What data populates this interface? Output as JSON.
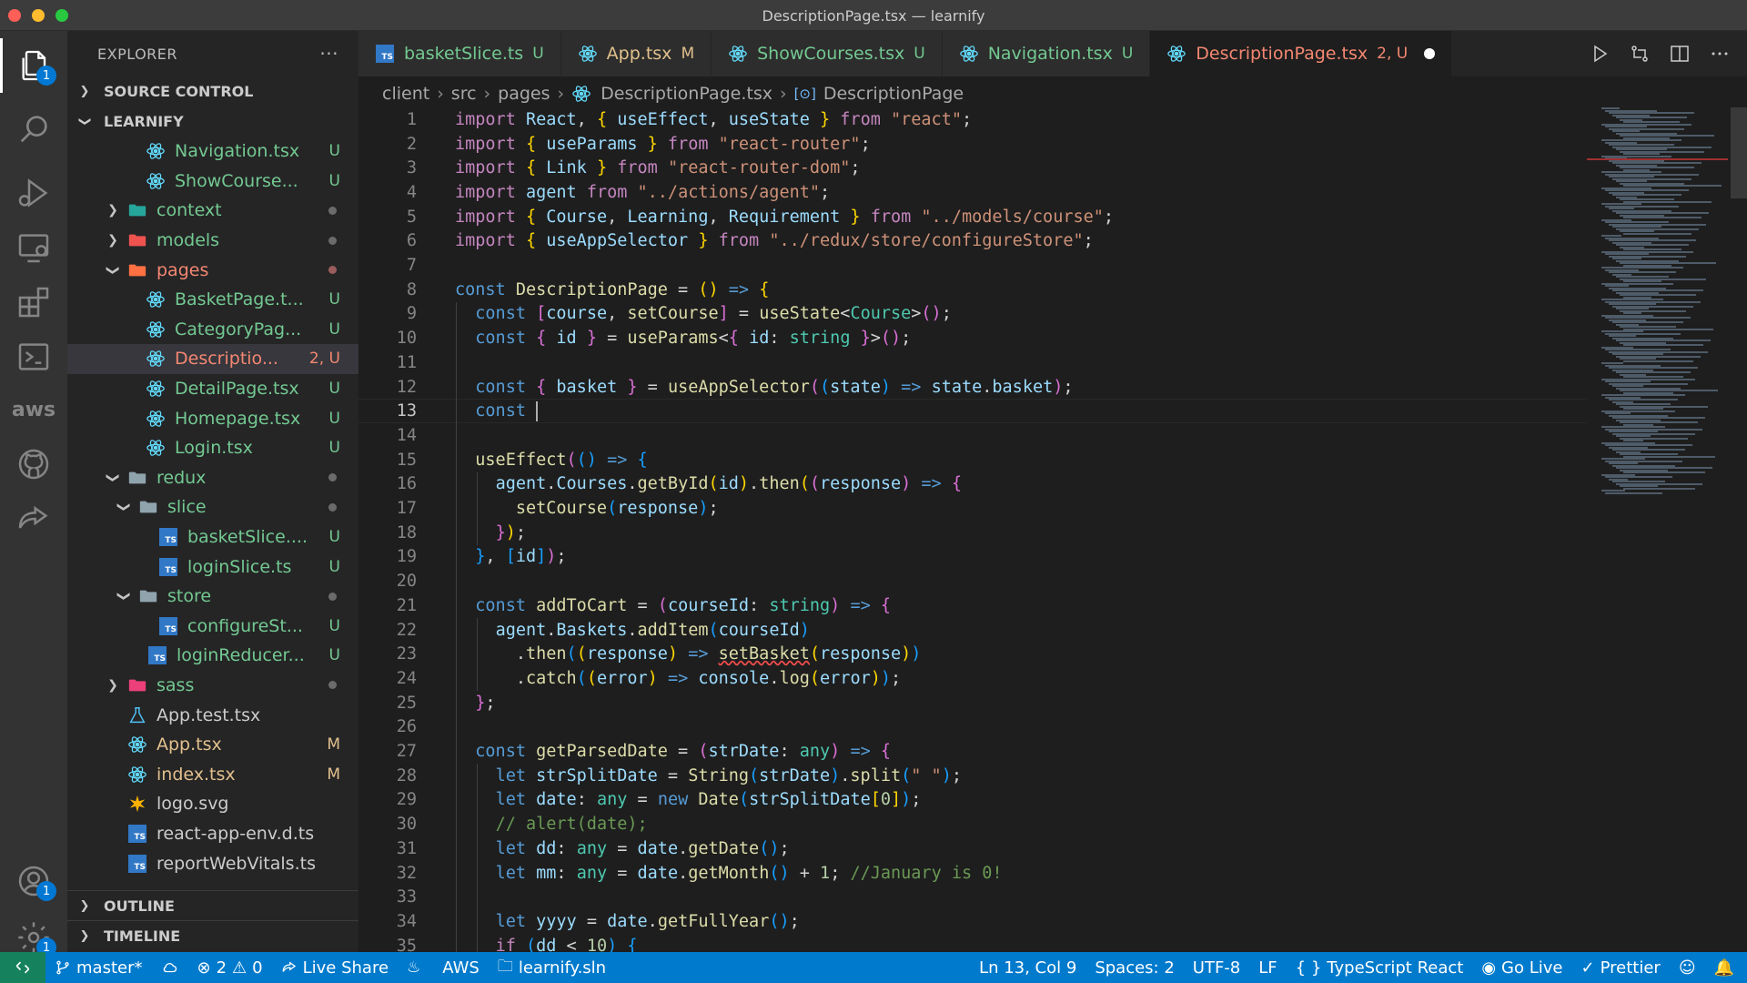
{
  "window": {
    "title": "DescriptionPage.tsx — learnify"
  },
  "activity": {
    "explorer_badge": "1",
    "accounts_badge": "1",
    "manage_badge": "1",
    "aws_label": "aws"
  },
  "explorer": {
    "title": "EXPLORER",
    "more": "···",
    "source_control": "SOURCE CONTROL",
    "project": "LEARNIFY",
    "outline": "OUTLINE",
    "timeline": "TIMELINE",
    "tree": [
      {
        "name": "Navigation.tsx",
        "status": "U",
        "icon": "react-icon",
        "indent": 86,
        "color": "green"
      },
      {
        "name": "ShowCourse...",
        "status": "U",
        "icon": "react-icon",
        "indent": 86,
        "color": "green"
      },
      {
        "name": "context",
        "status": "",
        "icon": "folder-context-icon",
        "indent": 66,
        "folder": "closed",
        "dot": true,
        "color": "green"
      },
      {
        "name": "models",
        "status": "",
        "icon": "folder-models-icon",
        "indent": 66,
        "folder": "closed",
        "dot": true,
        "color": "green"
      },
      {
        "name": "pages",
        "status": "",
        "icon": "folder-pages-icon",
        "indent": 66,
        "folder": "open",
        "dot": true,
        "dotred": true,
        "color": "red"
      },
      {
        "name": "BasketPage.t...",
        "status": "U",
        "icon": "react-icon",
        "indent": 86,
        "color": "green"
      },
      {
        "name": "CategoryPag...",
        "status": "U",
        "icon": "react-icon",
        "indent": 86,
        "color": "green"
      },
      {
        "name": "Descriptio...",
        "status": "2, U",
        "icon": "react-icon",
        "indent": 86,
        "color": "red",
        "selected": true
      },
      {
        "name": "DetailPage.tsx",
        "status": "U",
        "icon": "react-icon",
        "indent": 86,
        "color": "green"
      },
      {
        "name": "Homepage.tsx",
        "status": "U",
        "icon": "react-icon",
        "indent": 86,
        "color": "green"
      },
      {
        "name": "Login.tsx",
        "status": "U",
        "icon": "react-icon",
        "indent": 86,
        "color": "green"
      },
      {
        "name": "redux",
        "status": "",
        "icon": "folder-icon",
        "indent": 66,
        "folder": "open",
        "dot": true,
        "color": "green"
      },
      {
        "name": "slice",
        "status": "",
        "icon": "folder-icon",
        "indent": 78,
        "folder": "open",
        "dot": true,
        "color": "green"
      },
      {
        "name": "basketSlice....",
        "status": "U",
        "icon": "ts-icon",
        "indent": 100,
        "color": "green"
      },
      {
        "name": "loginSlice.ts",
        "status": "U",
        "icon": "ts-icon",
        "indent": 100,
        "color": "green"
      },
      {
        "name": "store",
        "status": "",
        "icon": "folder-icon",
        "indent": 78,
        "folder": "open",
        "dot": true,
        "color": "green"
      },
      {
        "name": "configureSt...",
        "status": "U",
        "icon": "ts-icon",
        "indent": 100,
        "color": "green"
      },
      {
        "name": "loginReducer...",
        "status": "U",
        "icon": "ts-icon",
        "indent": 88,
        "color": "green"
      },
      {
        "name": "sass",
        "status": "",
        "icon": "folder-sass-icon",
        "indent": 66,
        "folder": "closed",
        "dot": true,
        "color": "green"
      },
      {
        "name": "App.test.tsx",
        "status": "",
        "icon": "test-icon",
        "indent": 66,
        "color": "plain"
      },
      {
        "name": "App.tsx",
        "status": "M",
        "icon": "react-icon",
        "indent": 66,
        "color": "mod"
      },
      {
        "name": "index.tsx",
        "status": "M",
        "icon": "react-icon",
        "indent": 66,
        "color": "mod"
      },
      {
        "name": "logo.svg",
        "status": "",
        "icon": "svg-icon",
        "indent": 66,
        "color": "plain"
      },
      {
        "name": "react-app-env.d.ts",
        "status": "",
        "icon": "ts-icon",
        "indent": 66,
        "color": "plain"
      },
      {
        "name": "reportWebVitals.ts",
        "status": "",
        "icon": "ts-icon",
        "indent": 66,
        "color": "plain"
      }
    ]
  },
  "tabs": [
    {
      "name": "basketSlice.ts",
      "status": "U",
      "icon": "ts-icon",
      "color": "green"
    },
    {
      "name": "App.tsx",
      "status": "M",
      "icon": "react-icon",
      "color": "mod"
    },
    {
      "name": "ShowCourses.tsx",
      "status": "U",
      "icon": "react-icon",
      "color": "green"
    },
    {
      "name": "Navigation.tsx",
      "status": "U",
      "icon": "react-icon",
      "color": "green"
    },
    {
      "name": "DescriptionPage.tsx",
      "status": "2, U",
      "icon": "react-icon",
      "color": "red",
      "active": true,
      "dirty": true
    }
  ],
  "breadcrumbs": [
    "client",
    "src",
    "pages",
    "DescriptionPage.tsx",
    "DescriptionPage"
  ],
  "code": [
    "<span class='c'>import</span> <span class='v'>React</span>, <span class='y'>{</span> <span class='v'>useEffect</span>, <span class='v'>useState</span> <span class='y'>}</span> <span class='c'>from</span> <span class='s'>\"react\"</span>;",
    "<span class='c'>import</span> <span class='y'>{</span> <span class='v'>useParams</span> <span class='y'>}</span> <span class='c'>from</span> <span class='s'>\"react-router\"</span>;",
    "<span class='c'>import</span> <span class='y'>{</span> <span class='v'>Link</span> <span class='y'>}</span> <span class='c'>from</span> <span class='s'>\"react-router-dom\"</span>;",
    "<span class='c'>import</span> <span class='v'>agent</span> <span class='c'>from</span> <span class='s'>\"../actions/agent\"</span>;",
    "<span class='c'>import</span> <span class='y'>{</span> <span class='v'>Course</span>, <span class='v'>Learning</span>, <span class='v'>Requirement</span> <span class='y'>}</span> <span class='c'>from</span> <span class='s'>\"../models/course\"</span>;",
    "<span class='c'>import</span> <span class='y'>{</span> <span class='v'>useAppSelector</span> <span class='y'>}</span> <span class='c'>from</span> <span class='s'>\"../redux/store/configureStore\"</span>;",
    "",
    "<span class='k'>const</span> <span class='f'>DescriptionPage</span> = <span class='y'>()</span> <span class='k'>=&gt;</span> <span class='y'>{</span>",
    "  <span class='k'>const</span> <span class='p'>[</span><span class='v'>course</span>, <span class='f'>setCourse</span><span class='p'>]</span> = <span class='f'>useState</span>&lt;<span class='t'>Course</span>&gt;<span class='p'>()</span>;",
    "  <span class='k'>const</span> <span class='p'>{</span> <span class='v'>id</span> <span class='p'>}</span> = <span class='f'>useParams</span>&lt;<span class='p'>{</span> <span class='v'>id</span>: <span class='t'>string</span> <span class='p'>}</span>&gt;<span class='p'>()</span>;",
    "",
    "  <span class='k'>const</span> <span class='p'>{</span> <span class='v'>basket</span> <span class='p'>}</span> = <span class='f'>useAppSelector</span><span class='p'>(</span><span class='b'>(</span><span class='v'>state</span><span class='b'>)</span> <span class='k'>=&gt;</span> <span class='v'>state</span>.<span class='v'>basket</span><span class='p'>)</span>;",
    "  <span class='k'>const</span> <span class='cursor'></span>",
    "",
    "  <span class='f'>useEffect</span><span class='p'>(</span><span class='b'>()</span> <span class='k'>=&gt;</span> <span class='b'>{</span>",
    "    <span class='v'>agent</span>.<span class='v'>Courses</span>.<span class='f'>getById</span><span class='y'>(</span><span class='v'>id</span><span class='y'>)</span>.<span class='f'>then</span><span class='y'>(</span><span class='p'>(</span><span class='v'>response</span><span class='p'>)</span> <span class='k'>=&gt;</span> <span class='p'>{</span>",
    "      <span class='f'>setCourse</span><span class='b'>(</span><span class='v'>response</span><span class='b'>)</span>;",
    "    <span class='p'>}</span><span class='y'>)</span>;",
    "  <span class='b'>}</span>, <span class='b'>[</span><span class='v'>id</span><span class='b'>]</span><span class='p'>)</span>;",
    "",
    "  <span class='k'>const</span> <span class='f'>addToCart</span> = <span class='p'>(</span><span class='v'>courseId</span>: <span class='t'>string</span><span class='p'>)</span> <span class='k'>=&gt;</span> <span class='p'>{</span>",
    "    <span class='v'>agent</span>.<span class='v'>Baskets</span>.<span class='f'>addItem</span><span class='b'>(</span><span class='v'>courseId</span><span class='b'>)</span>",
    "      .<span class='f'>then</span><span class='b'>(</span><span class='y'>(</span><span class='v'>response</span><span class='y'>)</span> <span class='k'>=&gt;</span> <span class='f err'>setBasket</span><span class='y'>(</span><span class='v'>response</span><span class='y'>)</span><span class='b'>)</span>",
    "      .<span class='f'>catch</span><span class='b'>(</span><span class='y'>(</span><span class='v'>error</span><span class='y'>)</span> <span class='k'>=&gt;</span> <span class='v'>console</span>.<span class='f'>log</span><span class='y'>(</span><span class='v'>error</span><span class='y'>)</span><span class='b'>)</span>;",
    "  <span class='p'>}</span>;",
    "",
    "  <span class='k'>const</span> <span class='f'>getParsedDate</span> = <span class='p'>(</span><span class='v'>strDate</span>: <span class='t'>any</span><span class='p'>)</span> <span class='k'>=&gt;</span> <span class='p'>{</span>",
    "    <span class='k'>let</span> <span class='v'>strSplitDate</span> = <span class='f'>String</span><span class='b'>(</span><span class='v'>strDate</span><span class='b'>)</span>.<span class='f'>split</span><span class='b'>(</span><span class='s'>\" \"</span><span class='b'>)</span>;",
    "    <span class='k'>let</span> <span class='v'>date</span>: <span class='t'>any</span> = <span class='k'>new</span> <span class='f'>Date</span><span class='b'>(</span><span class='v'>strSplitDate</span><span class='y'>[</span><span class='n'>0</span><span class='y'>]</span><span class='b'>)</span>;",
    "    <span class='cm'>// alert(date);</span>",
    "    <span class='k'>let</span> <span class='v'>dd</span>: <span class='t'>any</span> = <span class='v'>date</span>.<span class='f'>getDate</span><span class='b'>()</span>;",
    "    <span class='k'>let</span> <span class='v'>mm</span>: <span class='t'>any</span> = <span class='v'>date</span>.<span class='f'>getMonth</span><span class='b'>()</span> + <span class='n'>1</span>; <span class='cm'>//January is 0!</span>",
    "",
    "    <span class='k'>let</span> <span class='v'>yyyy</span> = <span class='v'>date</span>.<span class='f'>getFullYear</span><span class='b'>()</span>;",
    "    <span class='c'>if</span> <span class='b'>(</span><span class='v'>dd</span> &lt; <span class='n'>10</span><span class='b'>)</span> <span class='b'>{</span>"
  ],
  "editor": {
    "current_line": 13
  },
  "status": {
    "branch": "master*",
    "errors": "2",
    "warnings": "0",
    "live_share": "Live Share",
    "aws": "AWS",
    "solution": "learnify.sln",
    "position": "Ln 13, Col 9",
    "spaces": "Spaces: 2",
    "encoding": "UTF-8",
    "eol": "LF",
    "language": "TypeScript React",
    "go_live": "Go Live",
    "prettier": "Prettier"
  }
}
